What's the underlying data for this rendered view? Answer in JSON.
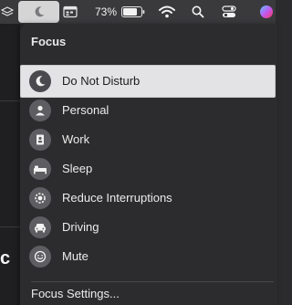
{
  "menubar": {
    "battery_percent": "73%",
    "icons": {
      "layers": "layers-icon",
      "focus": "moon-icon",
      "calendar": "calendar-icon",
      "battery": "battery-icon",
      "wifi": "wifi-icon",
      "search": "search-icon",
      "control_center": "control-center-icon",
      "siri": "siri-icon"
    }
  },
  "backdrop": {
    "letter": "c"
  },
  "focus_menu": {
    "title": "Focus",
    "items": [
      {
        "label": "Do Not Disturb",
        "icon": "moon-icon",
        "selected": true
      },
      {
        "label": "Personal",
        "icon": "person-icon",
        "selected": false
      },
      {
        "label": "Work",
        "icon": "id-badge-icon",
        "selected": false
      },
      {
        "label": "Sleep",
        "icon": "bed-icon",
        "selected": false
      },
      {
        "label": "Reduce Interruptions",
        "icon": "gear-badge-icon",
        "selected": false
      },
      {
        "label": "Driving",
        "icon": "car-icon",
        "selected": false
      },
      {
        "label": "Mute",
        "icon": "smiley-icon",
        "selected": false
      }
    ],
    "settings_label": "Focus Settings..."
  },
  "colors": {
    "menubar_bg": "#3a3a3d",
    "panel_bg": "#2c2c2e",
    "highlight_bg": "#e3e3e5",
    "icon_circle": "#5e5e62"
  }
}
